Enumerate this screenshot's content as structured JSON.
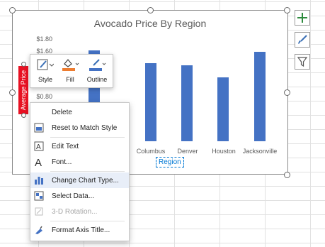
{
  "chart": {
    "title": "Avocado Price By Region",
    "y_axis_title": "Average Price",
    "x_axis_title": "Region",
    "y_ticks": [
      "$1.80",
      "$1.60",
      "$0.80"
    ]
  },
  "chart_data": {
    "type": "bar",
    "title": "Avocado Price By Region",
    "xlabel": "Region",
    "ylabel": "Average Price",
    "categories": [
      "",
      "Columbus",
      "Denver",
      "Houston",
      "Jacksonville"
    ],
    "visible_category_labels": [
      "Columbus",
      "Denver",
      "Houston",
      "Jacksonville"
    ],
    "values": [
      1.6,
      1.37,
      1.34,
      1.13,
      1.58
    ],
    "ylim": [
      0,
      1.8
    ],
    "grid": false,
    "bar_color": "#4472c4"
  },
  "mini_toolbar": {
    "style_label": "Style",
    "fill_label": "Fill",
    "outline_label": "Outline",
    "fill_color": "#ed7d31",
    "outline_color": "#4472c4"
  },
  "context_menu": {
    "items": [
      {
        "label": "Delete",
        "icon": "none"
      },
      {
        "label": "Reset to Match Style",
        "icon": "reset-style-icon"
      },
      {
        "label": "Edit Text",
        "icon": "edit-text-icon"
      },
      {
        "label": "Font...",
        "icon": "font-icon"
      },
      {
        "label": "Change Chart Type...",
        "icon": "chart-type-icon"
      },
      {
        "label": "Select Data...",
        "icon": "select-data-icon"
      },
      {
        "label": "3-D Rotation...",
        "icon": "rotation-icon"
      },
      {
        "label": "Format Axis Title...",
        "icon": "format-axis-icon"
      }
    ]
  },
  "side_toolbar": {
    "icons": [
      "chart-elements-icon",
      "chart-styles-icon",
      "chart-filters-icon"
    ]
  },
  "colors": {
    "accent": "#0078d4",
    "bar": "#4472c4",
    "selected_label": "#e81123"
  }
}
